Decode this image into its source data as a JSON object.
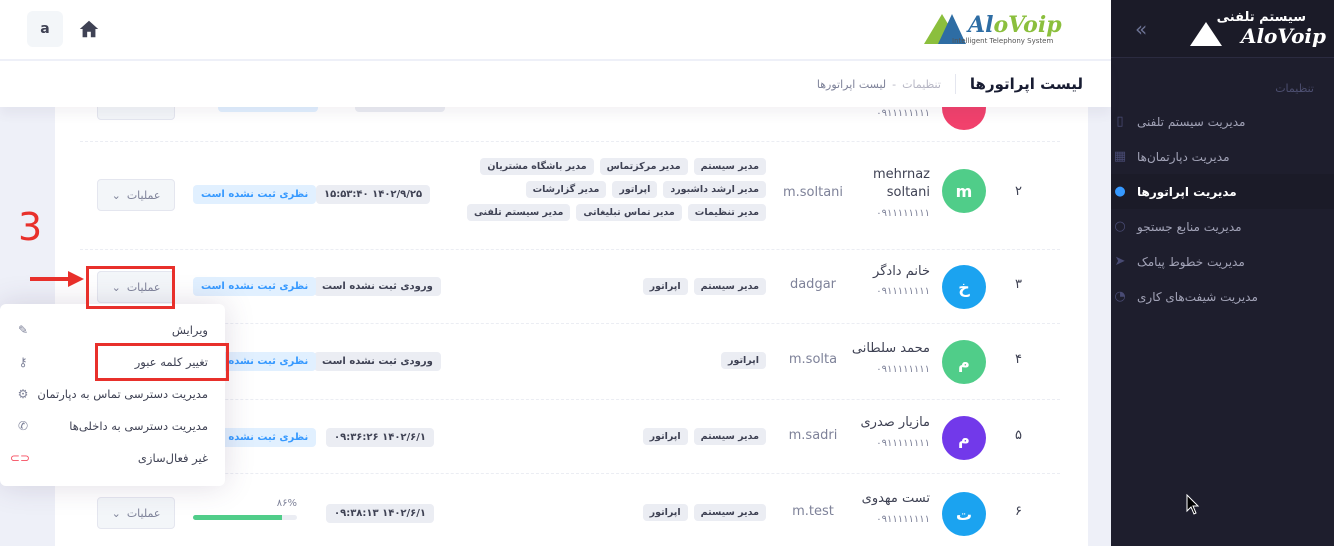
{
  "app": {
    "brand_name": "AloVoip",
    "brand_tagline": "Intelligent Telephony System",
    "system_title": "سیستم تلفنی"
  },
  "header": {
    "user_initial": "a"
  },
  "subheader": {
    "page_title": "لیست اپراتورها",
    "breadcrumb": [
      "تنظیمات",
      "-",
      "لیست اپراتورها"
    ]
  },
  "sidebar": {
    "section_title": "تنظیمات",
    "items": [
      {
        "label": "مدیریت سیستم تلفنی",
        "icon": "phone-device-icon",
        "active": false
      },
      {
        "label": "مدیریت دپارتمان‌ها",
        "icon": "building-icon",
        "active": false
      },
      {
        "label": "مدیریت اپراتورها",
        "icon": "users-icon",
        "active": true
      },
      {
        "label": "مدیریت منابع جستجو",
        "icon": "circle-icon",
        "active": false
      },
      {
        "label": "مدیریت خطوط پیامک",
        "icon": "send-icon",
        "active": false
      },
      {
        "label": "مدیریت شیفت‌های کاری",
        "icon": "timer-icon",
        "active": false
      }
    ]
  },
  "table": {
    "ops_label": "عملیات",
    "rows": [
      {
        "num": "۲",
        "avatar": "m",
        "avatar_color": "#50cd89",
        "name": "mehrnaz soltani",
        "phone": "۰۹۱۱۱۱۱۱۱۱",
        "username": "m.soltani",
        "roles": [
          "مدیر سیستم",
          "مدیر مرکزتماس",
          "مدیر باشگاه مشتریان",
          "مدیر ارشد داشبورد",
          "اپراتور",
          "مدیر گزارشات",
          "مدیر تنظیمات",
          "مدیر تماس تبلیغاتی",
          "مدیر سیستم تلفنی"
        ],
        "last_login": "۱۴۰۲/۹/۲۵ ۱۵:۵۳:۴۰",
        "survey": "نظری ثبت نشده است"
      },
      {
        "num": "۳",
        "avatar": "خ",
        "avatar_color": "#1ba3f0",
        "name": "خانم دادگر",
        "phone": "۰۹۱۱۱۱۱۱۱۱",
        "username": "dadgar",
        "roles": [
          "مدیر سیستم",
          "اپراتور"
        ],
        "last_login": "ورودی ثبت نشده است",
        "survey": "نظری ثبت نشده است"
      },
      {
        "num": "۴",
        "avatar": "م",
        "avatar_color": "#50cd89",
        "name": "محمد سلطانی",
        "phone": "۰۹۱۱۱۱۱۱۱۱",
        "username": "m.solta",
        "roles": [
          "اپراتور"
        ],
        "last_login": "ورودی ثبت نشده است",
        "survey": "نظری ثبت نشده است"
      },
      {
        "num": "۵",
        "avatar": "م",
        "avatar_color": "#7239ea",
        "name": "مازیار صدری",
        "phone": "۰۹۱۱۱۱۱۱۱۱",
        "username": "m.sadri",
        "roles": [
          "مدیر سیستم",
          "اپراتور"
        ],
        "last_login": "۱۴۰۲/۶/۱ ۰۹:۳۶:۲۶",
        "survey": "نظری ثبت نشده است"
      },
      {
        "num": "۶",
        "avatar": "ت",
        "avatar_color": "#1ba3f0",
        "name": "تست مهدوی",
        "phone": "۰۹۱۱۱۱۱۱۱۱",
        "username": "m.test",
        "roles": [
          "مدیر سیستم",
          "اپراتور"
        ],
        "last_login": "۱۴۰۲/۶/۱ ۰۹:۳۸:۱۳",
        "progress_label": "۸۶%",
        "progress": 0.86
      }
    ]
  },
  "dropdown": {
    "items": [
      {
        "label": "ویرایش",
        "icon": "edit-icon"
      },
      {
        "label": "تغییر کلمه عبور",
        "icon": "key-icon"
      },
      {
        "label": "مدیریت دسترسی تماس به دپارتمان",
        "icon": "gear-icon"
      },
      {
        "label": "مدیریت دسترسی به داخلی‌ها",
        "icon": "phone-icon"
      },
      {
        "label": "غیر فعال‌سازی",
        "icon": "toggle-off-icon"
      }
    ]
  },
  "annotation": {
    "step_number": "3"
  }
}
